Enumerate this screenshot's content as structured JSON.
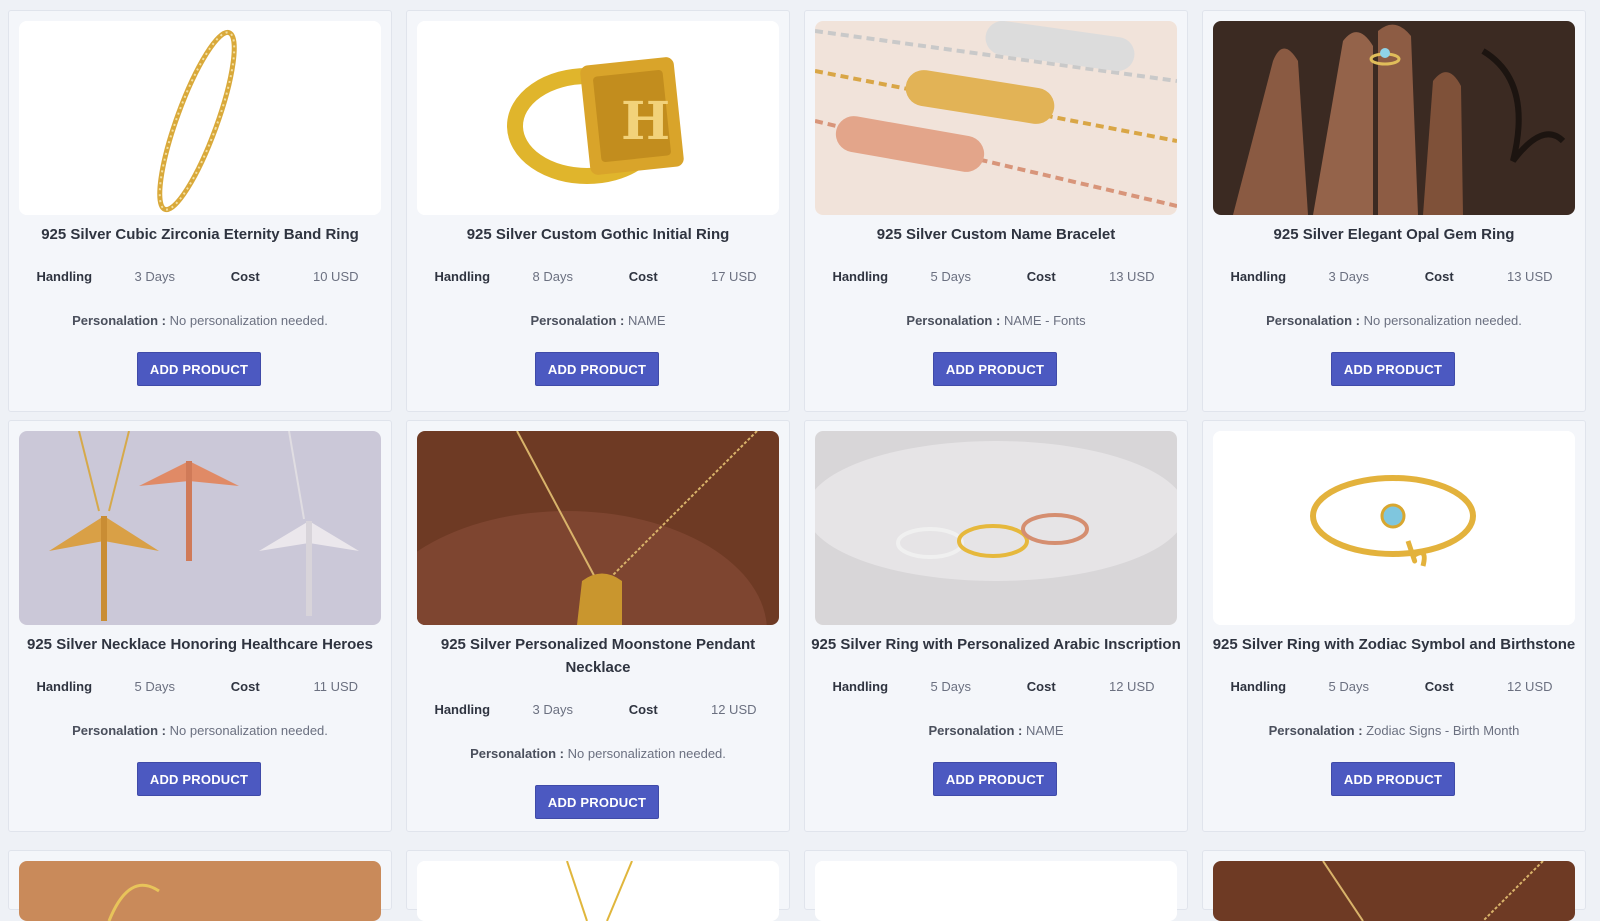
{
  "products": [
    {
      "title": "925 Silver Cubic Zirconia Eternity Band Ring",
      "handling_label": "Handling",
      "handling": "3 Days",
      "cost_label": "Cost",
      "cost": "10 USD",
      "pers_label": "Personalation :",
      "pers": "No personalization needed.",
      "button": "ADD PRODUCT",
      "image": "gold-eternity-band-ring"
    },
    {
      "title": "925 Silver Custom Gothic Initial Ring",
      "handling_label": "Handling",
      "handling": "8 Days",
      "cost_label": "Cost",
      "cost": "17 USD",
      "pers_label": "Personalation :",
      "pers": "NAME",
      "button": "ADD PRODUCT",
      "image": "gold-signet-initial-ring"
    },
    {
      "title": "925 Silver Custom Name Bracelet",
      "handling_label": "Handling",
      "handling": "5 Days",
      "cost_label": "Cost",
      "cost": "13 USD",
      "pers_label": "Personalation :",
      "pers": "NAME - Fonts",
      "button": "ADD PRODUCT",
      "image": "name-bracelets"
    },
    {
      "title": "925 Silver Elegant Opal Gem Ring",
      "handling_label": "Handling",
      "handling": "3 Days",
      "cost_label": "Cost",
      "cost": "13 USD",
      "pers_label": "Personalation :",
      "pers": "No personalization needed.",
      "button": "ADD PRODUCT",
      "image": "hand-with-opal-ring"
    },
    {
      "title": "925 Silver Necklace Honoring Healthcare Heroes",
      "handling_label": "Handling",
      "handling": "5 Days",
      "cost_label": "Cost",
      "cost": "11 USD",
      "pers_label": "Personalation :",
      "pers": "No personalization needed.",
      "button": "ADD PRODUCT",
      "image": "caduceus-necklaces"
    },
    {
      "title": "925 Silver Personalized Moonstone Pendant Necklace",
      "handling_label": "Handling",
      "handling": "3 Days",
      "cost_label": "Cost",
      "cost": "12 USD",
      "pers_label": "Personalation :",
      "pers": "No personalization needed.",
      "button": "ADD PRODUCT",
      "image": "moonstone-pendant"
    },
    {
      "title": "925 Silver Ring with Personalized Arabic Inscription",
      "handling_label": "Handling",
      "handling": "5 Days",
      "cost_label": "Cost",
      "cost": "12 USD",
      "pers_label": "Personalation :",
      "pers": "NAME",
      "button": "ADD PRODUCT",
      "image": "arabic-name-rings"
    },
    {
      "title": "925 Silver Ring with Zodiac Symbol and Birthstone",
      "handling_label": "Handling",
      "handling": "5 Days",
      "cost_label": "Cost",
      "cost": "12 USD",
      "pers_label": "Personalation :",
      "pers": "Zodiac Signs - Birth Month",
      "button": "ADD PRODUCT",
      "image": "zodiac-birthstone-ring"
    }
  ],
  "colors": {
    "button": "#4c59c1",
    "background": "#eef1f6",
    "card": "#f4f6fa"
  }
}
